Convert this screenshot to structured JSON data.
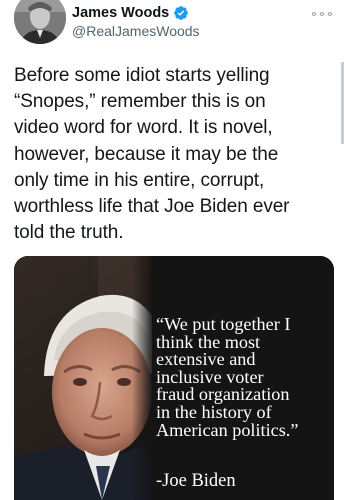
{
  "tweet": {
    "author": {
      "display_name": "James Woods",
      "handle": "@RealJamesWoods",
      "verified": true
    },
    "text": "Before some idiot starts yelling\n“Snopes,” remember this is on\nvideo word for word. It is novel,\nhowever, because it may be the\nonly time in his entire, corrupt,\nworthless life that Joe Biden ever\ntold the truth.",
    "media": {
      "quote": "“We put together I\nthink the most\nextensive and\ninclusive voter\nfraud organization\nin the history of\nAmerican politics.”",
      "attribution": "-Joe Biden"
    }
  },
  "icons": {
    "verified": "verified-badge-icon",
    "more": "more-options-icon"
  },
  "colors": {
    "verified_blue": "#1d9bf0",
    "text": "#0f1419",
    "secondary_text": "#536471",
    "media_background": "#141414"
  }
}
